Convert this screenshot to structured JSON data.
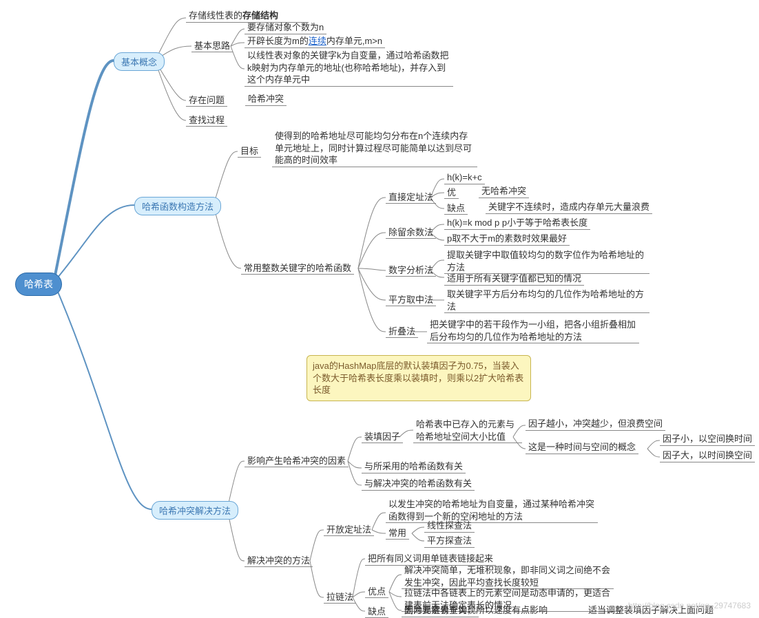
{
  "root": "哈希表",
  "b1": "基本概念",
  "b1_1": "存储线性表的",
  "b1_1_bold": "存储结构",
  "b1_2": "基本思路",
  "b1_2_1": "要存储对象个数为n",
  "b1_2_2a": "开辟长度为m的",
  "b1_2_2link": "连续",
  "b1_2_2b": "内存单元,m>n",
  "b1_2_3": "以线性表对象的关键字k为自变量，通过哈希函数把k映射为内存单元的地址(也称哈希地址)，并存入到这个内存单元中",
  "b1_3": "存在问题",
  "b1_3_1": "哈希冲突",
  "b1_4": "查找过程",
  "b2": "哈希函数构造方法",
  "b2_1": "目标",
  "b2_1_1": "使得到的哈希地址尽可能均匀分布在n个连续内存单元地址上，同时计算过程尽可能简单以达到尽可能高的时间效率",
  "b2_2": "常用整数关键字的哈希函数",
  "m1": "直接定址法",
  "m1_1": "h(k)=k+c",
  "m1_2": "优",
  "m1_2v": "无哈希冲突",
  "m1_3": "缺点",
  "m1_3v": "关键字不连续时，造成内存单元大量浪费",
  "m2": "除留余数法",
  "m2_1": "h(k)=k mod p p小于等于哈希表长度",
  "m2_2": "p取不大于m的素数时效果最好",
  "m3": "数字分析法",
  "m3_1": "提取关键字中取值较均匀的数字位作为哈希地址的方法",
  "m3_2": "适用于所有关键字值都已知的情况",
  "m4": "平方取中法",
  "m4_1": "取关键字平方后分布均匀的几位作为哈希地址的方法",
  "m5": "折叠法",
  "m5_1": "把关键字中的若干段作为一小组，把各小组折叠相加后分布均匀的几位作为哈希地址的方法",
  "note": "java的HashMap底层的默认装填因子为0.75，当装入个数大于哈希表长度乘以装填时，则乘以2扩大哈希表长度",
  "b3": "哈希冲突解决方法",
  "b3_1": "影响产生哈希冲突的因素",
  "f1": "装填因子",
  "f1_1": "哈希表中已存入的元素与哈希地址空间大小比值",
  "f1_2": "因子越小，冲突越少，但浪费空间",
  "f1_3": "这是一种时间与空间的概念",
  "f1_3a": "因子小，以空间换时间",
  "f1_3b": "因子大，以时间换空间",
  "f2": "与所采用的哈希函数有关",
  "f3": "与解决冲突的哈希函数有关",
  "b3_2": "解决冲突的方法",
  "s1": "开放定址法",
  "s1_1": "以发生冲突的哈希地址为自变量，通过某种哈希冲突函数得到一个新的空闲地址的方法",
  "s1_2": "常用",
  "s1_2a": "线性探查法",
  "s1_2b": "平方探查法",
  "s2": "拉链法",
  "s2_1": "把所有同义词用单链表链接起来",
  "s2_2": "优点",
  "s2_2a": "解决冲突简单，无堆积现象，即非同义词之间绝不会发生冲突，因此平均查找长度较短",
  "s2_2b": "拉链法中各链表上的元素空间是动态申请的，更适合建表前无法确定表长的情况",
  "s2_2c": "删除元素易于实现",
  "s2_3": "缺点",
  "s2_3a": "因为要链表查询，所以速度有点影响",
  "s2_3b": "适当调整装填因子解决上面问题",
  "watermark": "http://blog.csdn.net/qq_29747683"
}
